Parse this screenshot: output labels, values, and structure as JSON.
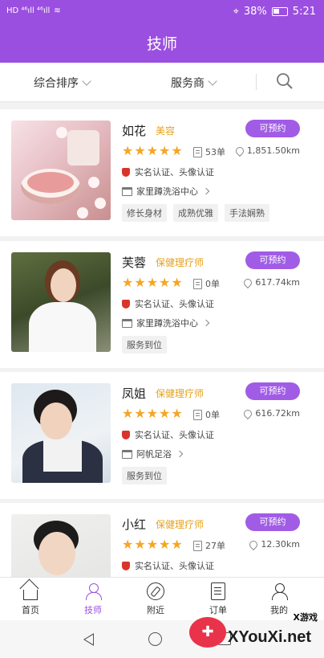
{
  "status_bar": {
    "left": "HD ⁴⁶ıll ⁴⁶ıll",
    "battery": "38%",
    "time": "5:21"
  },
  "header": {
    "title": "技师"
  },
  "filters": {
    "sort": "综合排序",
    "provider": "服务商"
  },
  "technicians": [
    {
      "name": "如花",
      "category": "美容",
      "rating": 5,
      "orders": "53单",
      "distance": "1,851.50km",
      "verification": "实名认证、头像认证",
      "shop": "家里蹲洗浴中心",
      "book_label": "可预约",
      "tags": [
        "修长身材",
        "成熟优雅",
        "手法娴熟"
      ]
    },
    {
      "name": "芙蓉",
      "category": "保健理疗师",
      "rating": 5,
      "orders": "0单",
      "distance": "617.74km",
      "verification": "实名认证、头像认证",
      "shop": "家里蹲洗浴中心",
      "book_label": "可预约",
      "tags": [
        "服务到位"
      ]
    },
    {
      "name": "凤姐",
      "category": "保健理疗师",
      "rating": 5,
      "orders": "0单",
      "distance": "616.72km",
      "verification": "实名认证、头像认证",
      "shop": "阿帆足浴",
      "book_label": "可预约",
      "tags": [
        "服务到位"
      ]
    },
    {
      "name": "小红",
      "category": "保健理疗师",
      "rating": 5,
      "orders": "27单",
      "distance": "12.30km",
      "verification": "实名认证、头像认证",
      "book_label": "可预约"
    }
  ],
  "bottom_nav": {
    "items": [
      {
        "label": "首页",
        "icon": "home-icon"
      },
      {
        "label": "技师",
        "icon": "technician-icon",
        "active": true
      },
      {
        "label": "附近",
        "icon": "compass-icon"
      },
      {
        "label": "订单",
        "icon": "order-icon"
      },
      {
        "label": "我的",
        "icon": "profile-icon"
      }
    ]
  },
  "watermark": {
    "top": "X游戏",
    "main": "XYouXi.net"
  },
  "colors": {
    "accent": "#9b4fe0",
    "tag": "#e6a11c",
    "star": "#f5a623",
    "verify": "#d9342b"
  }
}
